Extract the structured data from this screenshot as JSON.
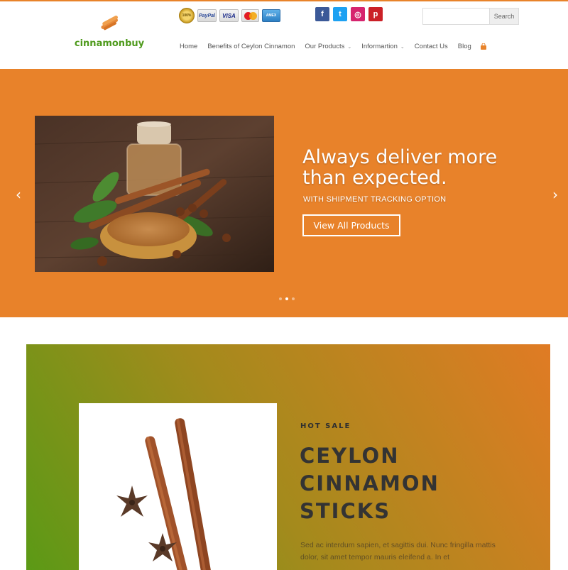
{
  "brand": {
    "name": "cinnamonbuy"
  },
  "payments": {
    "seal_label": "100%",
    "cards": [
      "PayPal",
      "VISA",
      "MasterCard",
      "AMERICAN EXPRESS"
    ]
  },
  "social": [
    {
      "name": "facebook-icon",
      "glyph": "f"
    },
    {
      "name": "twitter-icon",
      "glyph": "t"
    },
    {
      "name": "instagram-icon",
      "glyph": "◎"
    },
    {
      "name": "pinterest-icon",
      "glyph": "p"
    }
  ],
  "search": {
    "placeholder": "",
    "button_label": "Search"
  },
  "nav": {
    "items": [
      {
        "label": "Home"
      },
      {
        "label": "Benefits of Ceylon Cinnamon"
      },
      {
        "label": "Our Products",
        "dropdown": true
      },
      {
        "label": "Informartion",
        "dropdown": true
      },
      {
        "label": "Contact Us"
      },
      {
        "label": "Blog"
      }
    ]
  },
  "hero": {
    "heading": "Always deliver more than expected.",
    "subheading": "WITH SHIPMENT TRACKING OPTION",
    "button_label": "View All Products",
    "prev_arrow": "‹",
    "next_arrow": "›",
    "slide_count": 3,
    "active_slide": 2
  },
  "promo": {
    "kicker": "HOT SALE",
    "title_lines": [
      "CEYLON",
      "CINNAMON",
      "STICKS"
    ],
    "text": "Sed ac interdum sapien, et sagittis dui. Nunc fringilla mattis dolor, sit amet tempor mauris eleifend a. In et"
  },
  "colors": {
    "accent": "#e8822a",
    "brand_green": "#4e9a1c",
    "promo_gradient_start": "#5a9a16",
    "promo_gradient_end": "#e07b24"
  }
}
